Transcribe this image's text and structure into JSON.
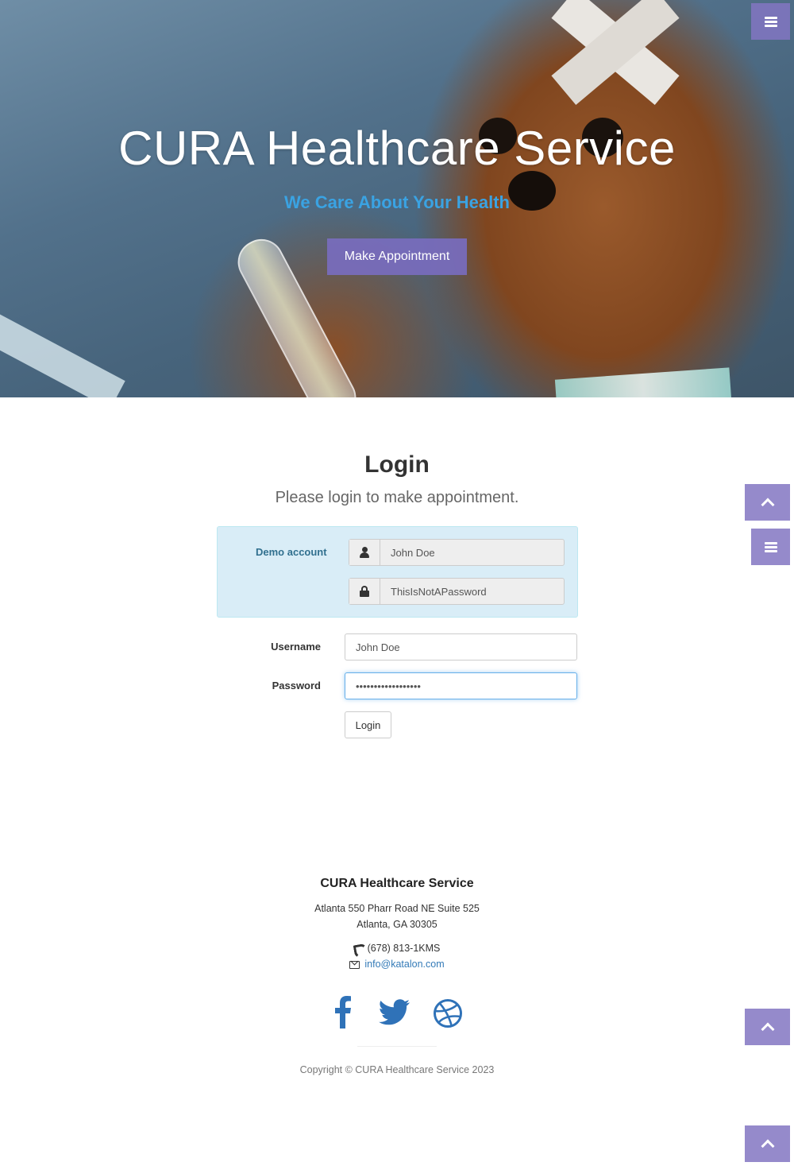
{
  "hero": {
    "title": "CURA Healthcare Service",
    "subtitle": "We Care About Your Health",
    "appointment_button": "Make Appointment"
  },
  "login": {
    "title": "Login",
    "subtitle": "Please login to make appointment.",
    "demo": {
      "label": "Demo account",
      "username": "John Doe",
      "password": "ThisIsNotAPassword"
    },
    "username_label": "Username",
    "username_value": "John Doe",
    "password_label": "Password",
    "password_value": "ThisIsNotAPassword",
    "login_button": "Login"
  },
  "footer": {
    "title": "CURA Healthcare Service",
    "address_line1": "Atlanta 550 Pharr Road NE Suite 525",
    "address_line2": "Atlanta, GA 30305",
    "phone": "(678) 813-1KMS",
    "email": "info@katalon.com",
    "social": [
      "facebook-icon",
      "twitter-icon",
      "dribbble-icon"
    ],
    "copyright": "Copyright © CURA Healthcare Service 2023"
  },
  "icons": {
    "menu": "menu-bars-icon",
    "scroll_top": "chevron-up-icon",
    "user": "user-icon",
    "lock": "lock-icon",
    "phone": "phone-icon",
    "email": "envelope-icon"
  },
  "colors": {
    "accent_purple": "#8276c2",
    "subtitle_blue": "#3aa3e3",
    "demo_bg": "#d9edf7",
    "demo_text": "#31708f",
    "link_blue": "#337ab7"
  }
}
